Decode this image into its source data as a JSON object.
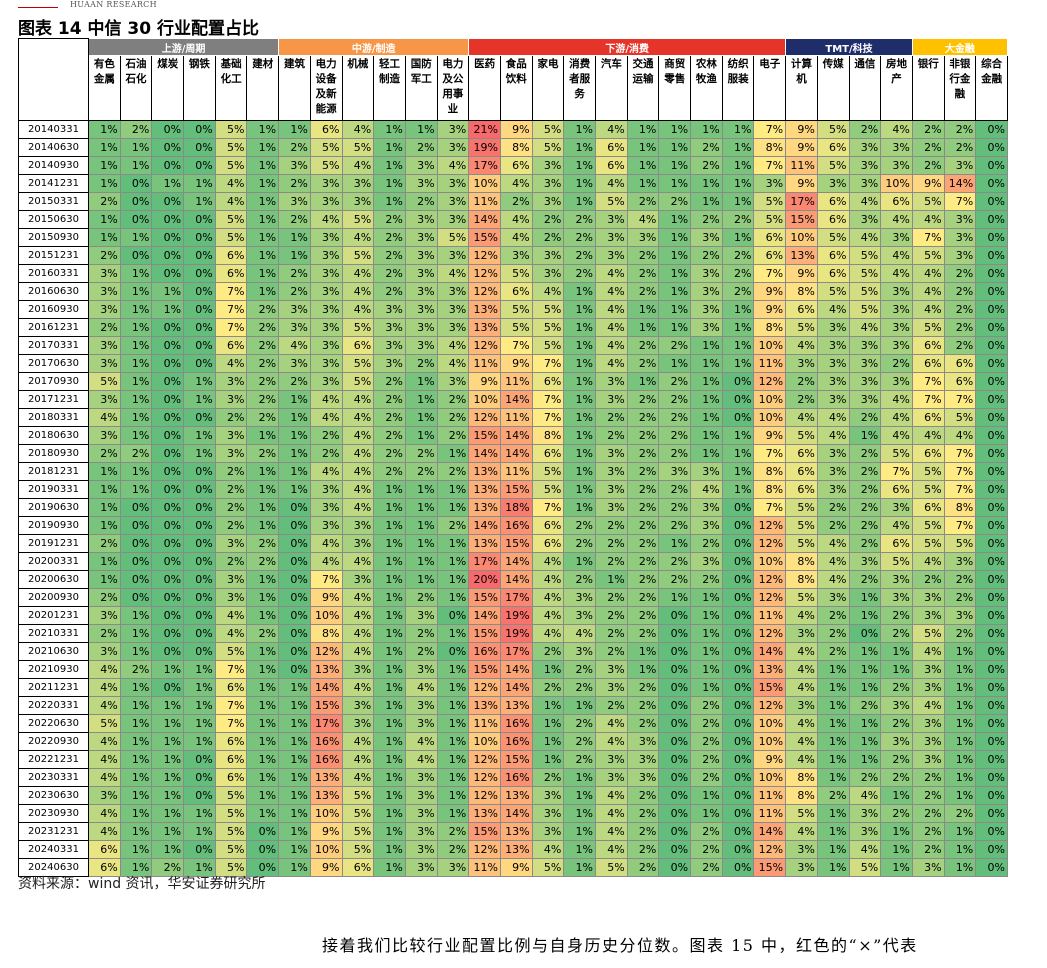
{
  "brand": "HUAAN RESEARCH",
  "figure_title": "图表 14 中信 30 行业配置占比",
  "source_note": "资料来源：wind 资讯，华安证券研究所",
  "body_text": "接着我们比较行业配置比例与自身历史分位数。图表 15 中，红色的“×”代表",
  "sections": [
    {
      "label": "上游/周期",
      "span": 6,
      "color": "#7f7f7f"
    },
    {
      "label": "中游/制造",
      "span": 6,
      "color": "#f79646"
    },
    {
      "label": "下游/消费",
      "span": 10,
      "color": "#e5352a"
    },
    {
      "label": "TMT/科技",
      "span": 4,
      "color": "#1f2d6b"
    },
    {
      "label": "大金融",
      "span": 4,
      "color": "#ffc000"
    }
  ],
  "industries": [
    "有色金属",
    "石油石化",
    "煤炭",
    "钢铁",
    "基础化工",
    "建材",
    "建筑",
    "电力设备及新能源",
    "机械",
    "轻工制造",
    "国防军工",
    "电力及公用事业",
    "医药",
    "食品饮料",
    "家电",
    "消费者服务",
    "汽车",
    "交通运输",
    "商贸零售",
    "农林牧渔",
    "纺织服装",
    "电子",
    "计算机",
    "传媒",
    "通信",
    "房地产",
    "银行",
    "非银行金融",
    "综合金融"
  ],
  "industry_display": [
    [
      "有色",
      "金属"
    ],
    [
      "石油",
      "石化"
    ],
    [
      "煤炭"
    ],
    [
      "钢铁"
    ],
    [
      "基础",
      "化工"
    ],
    [
      "建材"
    ],
    [
      "建筑"
    ],
    [
      "电力",
      "设备",
      "及新",
      "能源"
    ],
    [
      "机械"
    ],
    [
      "轻工",
      "制造"
    ],
    [
      "国防",
      "军工"
    ],
    [
      "电力",
      "及公",
      "用事",
      "业"
    ],
    [
      "医药"
    ],
    [
      "食品",
      "饮料"
    ],
    [
      "家电"
    ],
    [
      "消费",
      "者服",
      "务"
    ],
    [
      "汽车"
    ],
    [
      "交通",
      "运输"
    ],
    [
      "商贸",
      "零售"
    ],
    [
      "农林",
      "牧渔"
    ],
    [
      "纺织",
      "服装"
    ],
    [
      "电子"
    ],
    [
      "计算",
      "机"
    ],
    [
      "传媒"
    ],
    [
      "通信"
    ],
    [
      "房地",
      "产"
    ],
    [
      "银行"
    ],
    [
      "非银",
      "行金",
      "融"
    ],
    [
      "综合",
      "金融"
    ]
  ],
  "rows": [
    {
      "date": "20140331",
      "values": [
        1,
        2,
        0,
        0,
        5,
        1,
        1,
        6,
        4,
        1,
        1,
        3,
        21,
        9,
        5,
        1,
        4,
        1,
        1,
        1,
        1,
        7,
        9,
        5,
        2,
        4,
        2,
        2,
        0
      ]
    },
    {
      "date": "20140630",
      "values": [
        1,
        1,
        0,
        0,
        5,
        1,
        2,
        5,
        5,
        1,
        2,
        3,
        19,
        8,
        5,
        1,
        6,
        1,
        1,
        2,
        1,
        8,
        9,
        6,
        3,
        3,
        2,
        2,
        0
      ]
    },
    {
      "date": "20140930",
      "values": [
        1,
        1,
        0,
        0,
        5,
        1,
        3,
        5,
        4,
        1,
        3,
        4,
        17,
        6,
        3,
        1,
        6,
        1,
        1,
        2,
        1,
        7,
        11,
        5,
        3,
        3,
        2,
        3,
        0
      ]
    },
    {
      "date": "20141231",
      "values": [
        1,
        0,
        1,
        1,
        4,
        1,
        2,
        3,
        3,
        1,
        3,
        3,
        10,
        4,
        3,
        1,
        4,
        1,
        1,
        1,
        1,
        3,
        9,
        3,
        3,
        10,
        9,
        14,
        0
      ]
    },
    {
      "date": "20150331",
      "values": [
        2,
        0,
        0,
        1,
        4,
        1,
        3,
        3,
        3,
        1,
        2,
        3,
        11,
        2,
        3,
        1,
        5,
        2,
        2,
        1,
        1,
        5,
        17,
        6,
        4,
        6,
        5,
        7,
        0
      ]
    },
    {
      "date": "20150630",
      "values": [
        1,
        0,
        0,
        0,
        5,
        1,
        2,
        4,
        5,
        2,
        3,
        3,
        14,
        4,
        2,
        2,
        3,
        4,
        1,
        2,
        2,
        5,
        15,
        6,
        3,
        4,
        4,
        3,
        0
      ]
    },
    {
      "date": "20150930",
      "values": [
        1,
        1,
        0,
        0,
        5,
        1,
        1,
        3,
        4,
        2,
        3,
        5,
        15,
        4,
        2,
        2,
        3,
        3,
        1,
        3,
        1,
        6,
        10,
        5,
        4,
        3,
        7,
        3,
        0
      ]
    },
    {
      "date": "20151231",
      "values": [
        2,
        0,
        0,
        0,
        6,
        1,
        1,
        3,
        5,
        2,
        3,
        3,
        12,
        3,
        3,
        2,
        3,
        2,
        1,
        2,
        2,
        6,
        13,
        6,
        5,
        4,
        5,
        3,
        0
      ]
    },
    {
      "date": "20160331",
      "values": [
        3,
        1,
        0,
        0,
        6,
        1,
        2,
        3,
        4,
        2,
        3,
        4,
        12,
        5,
        3,
        2,
        4,
        2,
        1,
        3,
        2,
        7,
        9,
        6,
        5,
        4,
        4,
        2,
        0
      ]
    },
    {
      "date": "20160630",
      "values": [
        3,
        1,
        1,
        0,
        7,
        1,
        2,
        3,
        4,
        2,
        3,
        3,
        12,
        6,
        4,
        1,
        4,
        2,
        1,
        3,
        2,
        9,
        8,
        5,
        5,
        3,
        4,
        2,
        0
      ]
    },
    {
      "date": "20160930",
      "values": [
        3,
        1,
        1,
        0,
        7,
        2,
        3,
        3,
        4,
        3,
        3,
        3,
        13,
        5,
        5,
        1,
        4,
        1,
        1,
        3,
        1,
        9,
        6,
        4,
        5,
        3,
        4,
        2,
        0
      ]
    },
    {
      "date": "20161231",
      "values": [
        2,
        1,
        0,
        0,
        7,
        2,
        3,
        3,
        5,
        3,
        3,
        3,
        13,
        5,
        5,
        1,
        4,
        1,
        1,
        3,
        1,
        8,
        5,
        3,
        4,
        3,
        5,
        2,
        0
      ]
    },
    {
      "date": "20170331",
      "values": [
        3,
        1,
        0,
        0,
        6,
        2,
        4,
        3,
        6,
        3,
        3,
        4,
        12,
        7,
        5,
        1,
        4,
        2,
        2,
        1,
        1,
        10,
        4,
        3,
        3,
        3,
        6,
        2,
        0
      ]
    },
    {
      "date": "20170630",
      "values": [
        3,
        1,
        0,
        0,
        4,
        2,
        3,
        3,
        5,
        3,
        2,
        4,
        11,
        9,
        7,
        1,
        4,
        2,
        1,
        1,
        1,
        11,
        3,
        3,
        3,
        2,
        6,
        6,
        0
      ]
    },
    {
      "date": "20170930",
      "values": [
        5,
        1,
        0,
        1,
        3,
        2,
        2,
        3,
        5,
        2,
        1,
        3,
        9,
        11,
        6,
        1,
        3,
        1,
        2,
        1,
        0,
        12,
        2,
        3,
        3,
        3,
        7,
        6,
        0
      ]
    },
    {
      "date": "20171231",
      "values": [
        3,
        1,
        0,
        1,
        3,
        2,
        1,
        4,
        4,
        2,
        1,
        2,
        10,
        14,
        7,
        1,
        3,
        2,
        2,
        1,
        0,
        10,
        2,
        3,
        3,
        4,
        7,
        7,
        0
      ]
    },
    {
      "date": "20180331",
      "values": [
        4,
        1,
        0,
        0,
        2,
        2,
        1,
        4,
        4,
        2,
        1,
        2,
        12,
        11,
        7,
        1,
        2,
        2,
        2,
        1,
        0,
        10,
        4,
        4,
        2,
        4,
        6,
        5,
        0
      ]
    },
    {
      "date": "20180630",
      "values": [
        3,
        1,
        0,
        1,
        3,
        1,
        1,
        2,
        4,
        2,
        1,
        2,
        15,
        14,
        8,
        1,
        2,
        2,
        2,
        1,
        1,
        9,
        5,
        4,
        1,
        4,
        4,
        4,
        0
      ]
    },
    {
      "date": "20180930",
      "values": [
        2,
        2,
        0,
        1,
        3,
        2,
        1,
        2,
        4,
        2,
        2,
        1,
        14,
        14,
        6,
        1,
        3,
        2,
        2,
        1,
        1,
        7,
        6,
        3,
        2,
        5,
        6,
        7,
        0
      ]
    },
    {
      "date": "20181231",
      "values": [
        1,
        1,
        0,
        0,
        2,
        1,
        1,
        4,
        4,
        2,
        2,
        2,
        13,
        11,
        5,
        1,
        3,
        2,
        3,
        3,
        1,
        8,
        6,
        3,
        2,
        7,
        5,
        7,
        0
      ]
    },
    {
      "date": "20190331",
      "values": [
        1,
        1,
        0,
        0,
        2,
        1,
        1,
        3,
        4,
        1,
        1,
        1,
        13,
        15,
        5,
        1,
        3,
        2,
        2,
        4,
        1,
        8,
        6,
        3,
        2,
        6,
        5,
        7,
        0
      ]
    },
    {
      "date": "20190630",
      "values": [
        1,
        0,
        0,
        0,
        2,
        1,
        0,
        3,
        4,
        1,
        1,
        1,
        13,
        18,
        7,
        1,
        3,
        2,
        2,
        3,
        0,
        7,
        5,
        2,
        2,
        3,
        6,
        8,
        0
      ]
    },
    {
      "date": "20190930",
      "values": [
        1,
        0,
        0,
        0,
        2,
        1,
        0,
        3,
        3,
        1,
        1,
        2,
        14,
        16,
        6,
        2,
        2,
        2,
        2,
        3,
        0,
        12,
        5,
        2,
        2,
        4,
        5,
        7,
        0
      ]
    },
    {
      "date": "20191231",
      "values": [
        2,
        0,
        0,
        0,
        3,
        2,
        0,
        4,
        3,
        1,
        1,
        1,
        13,
        15,
        6,
        2,
        2,
        2,
        1,
        2,
        0,
        12,
        5,
        4,
        2,
        6,
        5,
        5,
        0
      ]
    },
    {
      "date": "20200331",
      "values": [
        1,
        0,
        0,
        0,
        2,
        2,
        0,
        4,
        4,
        1,
        1,
        1,
        17,
        14,
        4,
        1,
        2,
        2,
        2,
        3,
        0,
        10,
        8,
        4,
        3,
        5,
        4,
        3,
        0
      ]
    },
    {
      "date": "20200630",
      "values": [
        1,
        0,
        0,
        0,
        3,
        1,
        0,
        7,
        3,
        1,
        1,
        1,
        20,
        14,
        4,
        2,
        1,
        2,
        2,
        2,
        0,
        12,
        8,
        4,
        2,
        3,
        2,
        2,
        0
      ]
    },
    {
      "date": "20200930",
      "values": [
        2,
        0,
        0,
        0,
        3,
        1,
        0,
        9,
        4,
        1,
        2,
        1,
        15,
        17,
        4,
        3,
        2,
        2,
        1,
        1,
        0,
        12,
        5,
        3,
        1,
        3,
        3,
        2,
        0
      ]
    },
    {
      "date": "20201231",
      "values": [
        3,
        1,
        0,
        0,
        4,
        1,
        0,
        10,
        4,
        1,
        3,
        0,
        14,
        19,
        4,
        3,
        2,
        2,
        0,
        1,
        0,
        11,
        4,
        2,
        1,
        2,
        3,
        3,
        0
      ]
    },
    {
      "date": "20210331",
      "values": [
        2,
        1,
        0,
        0,
        4,
        2,
        0,
        8,
        4,
        1,
        2,
        1,
        15,
        19,
        4,
        4,
        2,
        2,
        0,
        1,
        0,
        12,
        3,
        2,
        0,
        2,
        5,
        2,
        0
      ]
    },
    {
      "date": "20210630",
      "values": [
        3,
        1,
        0,
        0,
        5,
        1,
        0,
        12,
        4,
        1,
        2,
        0,
        16,
        17,
        2,
        3,
        2,
        1,
        0,
        1,
        0,
        14,
        4,
        2,
        1,
        1,
        4,
        1,
        0
      ]
    },
    {
      "date": "20210930",
      "values": [
        4,
        2,
        1,
        1,
        7,
        1,
        0,
        13,
        3,
        1,
        3,
        1,
        15,
        14,
        1,
        2,
        3,
        1,
        0,
        1,
        0,
        13,
        4,
        1,
        1,
        1,
        3,
        1,
        0
      ]
    },
    {
      "date": "20211231",
      "values": [
        4,
        1,
        0,
        1,
        6,
        1,
        1,
        14,
        4,
        1,
        4,
        1,
        12,
        14,
        2,
        2,
        3,
        2,
        0,
        1,
        0,
        15,
        4,
        1,
        1,
        2,
        3,
        1,
        0
      ]
    },
    {
      "date": "20220331",
      "values": [
        4,
        1,
        1,
        1,
        7,
        1,
        1,
        15,
        3,
        1,
        3,
        1,
        13,
        13,
        1,
        1,
        2,
        2,
        0,
        2,
        0,
        12,
        3,
        1,
        2,
        3,
        4,
        1,
        0
      ]
    },
    {
      "date": "20220630",
      "values": [
        5,
        1,
        1,
        1,
        7,
        1,
        1,
        17,
        3,
        1,
        3,
        1,
        11,
        16,
        1,
        2,
        4,
        2,
        0,
        2,
        0,
        10,
        4,
        1,
        1,
        2,
        3,
        1,
        0
      ]
    },
    {
      "date": "20220930",
      "values": [
        4,
        1,
        1,
        1,
        6,
        1,
        1,
        16,
        4,
        1,
        4,
        1,
        10,
        16,
        1,
        2,
        4,
        3,
        0,
        2,
        0,
        10,
        4,
        1,
        1,
        3,
        3,
        1,
        0
      ]
    },
    {
      "date": "20221231",
      "values": [
        4,
        1,
        1,
        0,
        6,
        1,
        1,
        16,
        4,
        1,
        4,
        1,
        12,
        15,
        1,
        2,
        3,
        3,
        0,
        2,
        0,
        9,
        4,
        1,
        1,
        2,
        3,
        1,
        0
      ]
    },
    {
      "date": "20230331",
      "values": [
        4,
        1,
        1,
        0,
        6,
        1,
        1,
        13,
        4,
        1,
        3,
        1,
        12,
        16,
        2,
        1,
        3,
        3,
        0,
        2,
        0,
        10,
        8,
        1,
        2,
        2,
        2,
        1,
        0
      ]
    },
    {
      "date": "20230630",
      "values": [
        3,
        1,
        1,
        0,
        5,
        1,
        1,
        13,
        5,
        1,
        3,
        1,
        12,
        13,
        3,
        1,
        4,
        2,
        0,
        1,
        0,
        11,
        8,
        2,
        4,
        1,
        2,
        1,
        0
      ]
    },
    {
      "date": "20230930",
      "values": [
        4,
        1,
        1,
        1,
        5,
        1,
        1,
        10,
        5,
        1,
        3,
        1,
        13,
        14,
        3,
        1,
        4,
        2,
        0,
        1,
        0,
        11,
        5,
        1,
        3,
        2,
        2,
        2,
        0
      ]
    },
    {
      "date": "20231231",
      "values": [
        4,
        1,
        1,
        1,
        5,
        0,
        1,
        9,
        5,
        1,
        3,
        2,
        15,
        13,
        3,
        1,
        4,
        2,
        0,
        2,
        0,
        14,
        4,
        1,
        3,
        1,
        2,
        1,
        0
      ]
    },
    {
      "date": "20240331",
      "values": [
        6,
        1,
        1,
        0,
        5,
        0,
        1,
        10,
        5,
        1,
        3,
        2,
        12,
        13,
        4,
        1,
        4,
        2,
        0,
        2,
        0,
        12,
        3,
        1,
        4,
        1,
        2,
        1,
        0
      ]
    },
    {
      "date": "20240630",
      "values": [
        6,
        1,
        2,
        1,
        5,
        0,
        1,
        9,
        6,
        1,
        3,
        3,
        11,
        9,
        5,
        1,
        5,
        2,
        0,
        2,
        0,
        15,
        3,
        1,
        5,
        1,
        3,
        1,
        0
      ]
    }
  ],
  "color_scale": {
    "low": "#63be7b",
    "mid": "#ffeb84",
    "high": "#f8696b",
    "mid_value": 7,
    "high_value": 20
  }
}
